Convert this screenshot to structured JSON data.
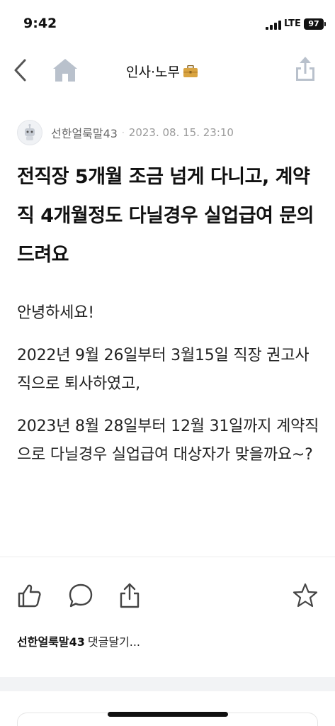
{
  "status_bar": {
    "time": "9:42",
    "network": "LTE",
    "battery": "97"
  },
  "nav": {
    "title": "인사·노무"
  },
  "post": {
    "author": "선한얼룩말43",
    "date": "2023. 08. 15. 23:10",
    "title": "전직장 5개월 조금 넘게 다니고, 계약직 4개월정도 다닐경우 실업급여 문의드려요",
    "body": [
      "안녕하세요!",
      "2022년 9월 26일부터 3월15일 직장 권고사직으로 퇴사하였고,",
      "2023년 8월 28일부터 12월 31일까지 계약직으로 다닐경우 실업급여 대상자가 맞을까요~?"
    ]
  },
  "comment": {
    "author": "선한얼룩말43",
    "placeholder": "댓글달기..."
  },
  "colors": {
    "nav_icon": "#b9c1cc",
    "briefcase": "#d9a441",
    "action_icon": "#444444"
  }
}
